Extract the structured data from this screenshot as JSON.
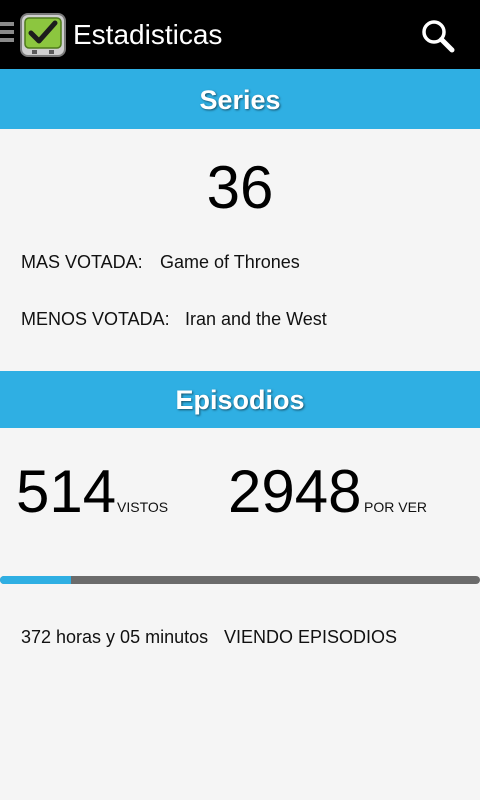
{
  "app": {
    "title": "Estadisticas"
  },
  "icons": {
    "menu": "menu-icon",
    "app": "tv-check-icon",
    "search": "search-icon"
  },
  "colors": {
    "accent": "#2fafe3",
    "actionbar": "#000000",
    "progress_track": "#6b6b6b"
  },
  "series": {
    "header": "Series",
    "count": "36",
    "most_voted_label": "MAS VOTADA:",
    "most_voted_value": "Game of Thrones",
    "least_voted_label": "MENOS VOTADA:",
    "least_voted_value": "Iran and the West"
  },
  "episodios": {
    "header": "Episodios",
    "watched_count": "514",
    "watched_label": "VISTOS",
    "pending_count": "2948",
    "pending_label": "POR VER",
    "progress_fraction": 0.148,
    "time_watched": "372 horas y 05 minutos",
    "time_label": "VIENDO EPISODIOS"
  }
}
